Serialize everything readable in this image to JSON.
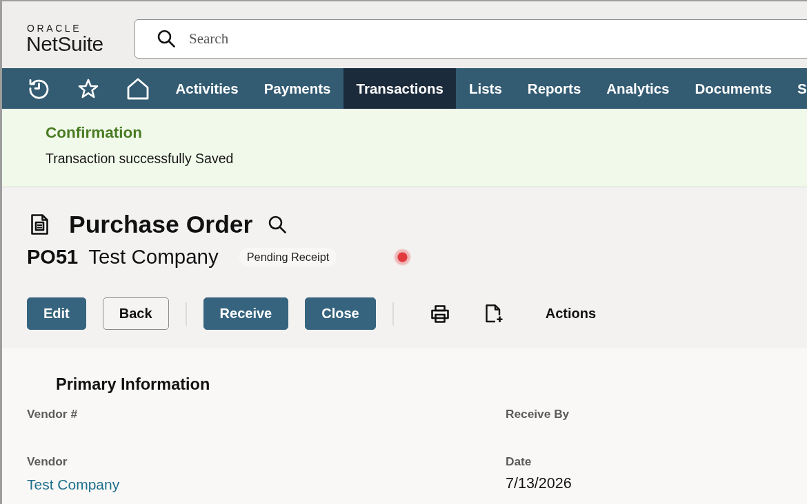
{
  "header": {
    "logo": {
      "brand": "ORACLE",
      "product": "NetSuite"
    },
    "search": {
      "placeholder": "Search"
    }
  },
  "nav": {
    "items": [
      {
        "label": "Activities",
        "selected": false
      },
      {
        "label": "Payments",
        "selected": false
      },
      {
        "label": "Transactions",
        "selected": true
      },
      {
        "label": "Lists",
        "selected": false
      },
      {
        "label": "Reports",
        "selected": false
      },
      {
        "label": "Analytics",
        "selected": false
      },
      {
        "label": "Documents",
        "selected": false
      },
      {
        "label": "S",
        "selected": false
      }
    ]
  },
  "confirmation": {
    "title": "Confirmation",
    "message": "Transaction successfully Saved"
  },
  "record": {
    "type": "Purchase Order",
    "number": "PO51",
    "name": "Test Company",
    "status": "Pending Receipt"
  },
  "toolbar": {
    "button_groups": [
      [
        {
          "label": "Edit",
          "kind": "primary"
        },
        {
          "label": "Back",
          "kind": "secondary"
        }
      ],
      [
        {
          "label": "Receive",
          "kind": "primary"
        },
        {
          "label": "Close",
          "kind": "primary"
        }
      ]
    ],
    "menu": "Actions"
  },
  "primary_information": {
    "title": "Primary Information",
    "fields": [
      {
        "label": "Vendor #",
        "kind": "empty"
      },
      {
        "label": "Receive By",
        "kind": "empty"
      },
      {
        "label": "Vendor",
        "kind": "link",
        "value": "Test Company"
      },
      {
        "label": "Date",
        "kind": "text",
        "value": "7/13/2026"
      }
    ]
  }
}
